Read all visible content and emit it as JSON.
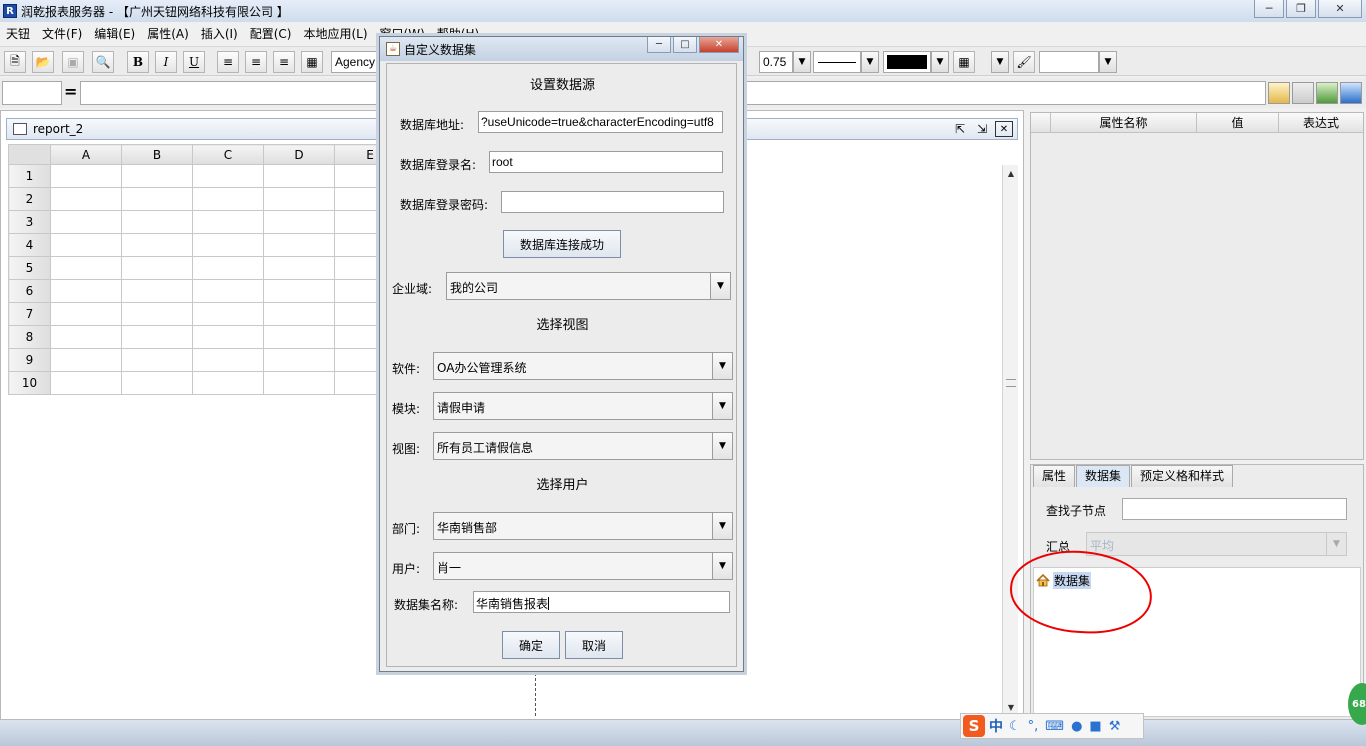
{
  "window": {
    "title": "润乾报表服务器 - 【广州天钮网络科技有限公司 】",
    "app_icon": "R"
  },
  "menu": [
    "天钮",
    "文件(F)",
    "编辑(E)",
    "属性(A)",
    "插入(I)",
    "配置(C)",
    "本地应用(L)",
    "窗口(W)",
    "帮助(H)"
  ],
  "toolbar": {
    "font_name": "Agency",
    "line_width": "0.75",
    "bold": "B",
    "italic": "I",
    "underline": "U",
    "icons": [
      "new-file-icon",
      "open-folder-icon",
      "save-icon",
      "print-preview-icon",
      "bold-icon",
      "italic-icon",
      "underline-icon",
      "align-left-icon",
      "align-center-icon",
      "align-right-icon",
      "table-icon",
      "border-icon",
      "paint-icon"
    ],
    "border_color": "#000000"
  },
  "formula": {
    "equals": "="
  },
  "report": {
    "name": "report_2",
    "columns": [
      "A",
      "B",
      "C",
      "D",
      "E"
    ],
    "rows": [
      "1",
      "2",
      "3",
      "4",
      "5",
      "6",
      "7",
      "8",
      "9",
      "10"
    ]
  },
  "properties_panel": {
    "headers": [
      "属性名称",
      "值",
      "表达式"
    ]
  },
  "lower_panel": {
    "tabs": [
      "属性",
      "数据集",
      "预定义格和样式"
    ],
    "active_tab": "数据集",
    "find_child_label": "查找子节点",
    "summary_label": "汇总",
    "summary_value": "平均",
    "tree_root": "数据集"
  },
  "dialog": {
    "title": "自定义数据集",
    "section_datasource": "设置数据源",
    "db_url_label": "数据库地址:",
    "db_url_value": "?useUnicode=true&characterEncoding=utf8",
    "db_user_label": "数据库登录名:",
    "db_user_value": "root",
    "db_pass_label": "数据库登录密码:",
    "db_pass_value": "",
    "connect_button": "数据库连接成功",
    "domain_label": "企业域:",
    "domain_value": "我的公司",
    "section_view": "选择视图",
    "software_label": "软件:",
    "software_value": "OA办公管理系统",
    "module_label": "模块:",
    "module_value": "请假申请",
    "view_label": "视图:",
    "view_value": "所有员工请假信息",
    "section_user": "选择用户",
    "dept_label": "部门:",
    "dept_value": "华南销售部",
    "user_label": "用户:",
    "user_value": "肖一",
    "dataset_name_label": "数据集名称:",
    "dataset_name_value": "华南销售报表",
    "ok_button": "确定",
    "cancel_button": "取消"
  },
  "ime": {
    "logo": "S",
    "mode": "中"
  },
  "badge": "68"
}
